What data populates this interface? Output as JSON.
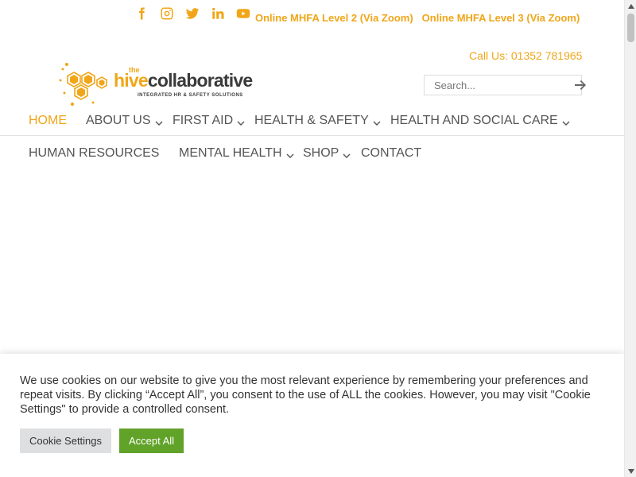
{
  "social_icons": [
    "facebook-icon",
    "instagram-icon",
    "twitter-icon",
    "linkedin-icon",
    "youtube-icon"
  ],
  "top_links": [
    "Online MHFA Level 2 (Via Zoom)",
    "Online MHFA Level 3 (Via Zoom)"
  ],
  "header": {
    "call": "Call Us: 01352 781965",
    "search_placeholder": "Search..."
  },
  "logo": {
    "the": "the",
    "hive": "hive",
    "collaborative": "collaborative",
    "tagline": "INTEGRATED HR & SAFETY SOLUTIONS"
  },
  "nav": {
    "row1": [
      {
        "label": "HOME",
        "active": true,
        "dropdown": false
      },
      {
        "label": "ABOUT US",
        "active": false,
        "dropdown": true
      },
      {
        "label": "FIRST AID",
        "active": false,
        "dropdown": true
      },
      {
        "label": "HEALTH & SAFETY",
        "active": false,
        "dropdown": true
      },
      {
        "label": "HEALTH AND SOCIAL CARE",
        "active": false,
        "dropdown": true
      }
    ],
    "row2": [
      {
        "label": "HUMAN RESOURCES",
        "active": false,
        "dropdown": false
      },
      {
        "label": "MENTAL HEALTH",
        "active": false,
        "dropdown": true
      },
      {
        "label": "SHOP",
        "active": false,
        "dropdown": true
      },
      {
        "label": "CONTACT",
        "active": false,
        "dropdown": false
      }
    ]
  },
  "cookie": {
    "text": "We use cookies on our website to give you the most relevant experience by remembering your preferences and repeat visits. By clicking “Accept All”, you consent to the use of ALL the cookies. However, you may visit \"Cookie Settings\" to provide a controlled consent.",
    "settings_label": "Cookie Settings",
    "accept_label": "Accept All"
  },
  "colors": {
    "accent": "#f0a618",
    "accept_button": "#61a229",
    "settings_button": "#dedfe0"
  }
}
